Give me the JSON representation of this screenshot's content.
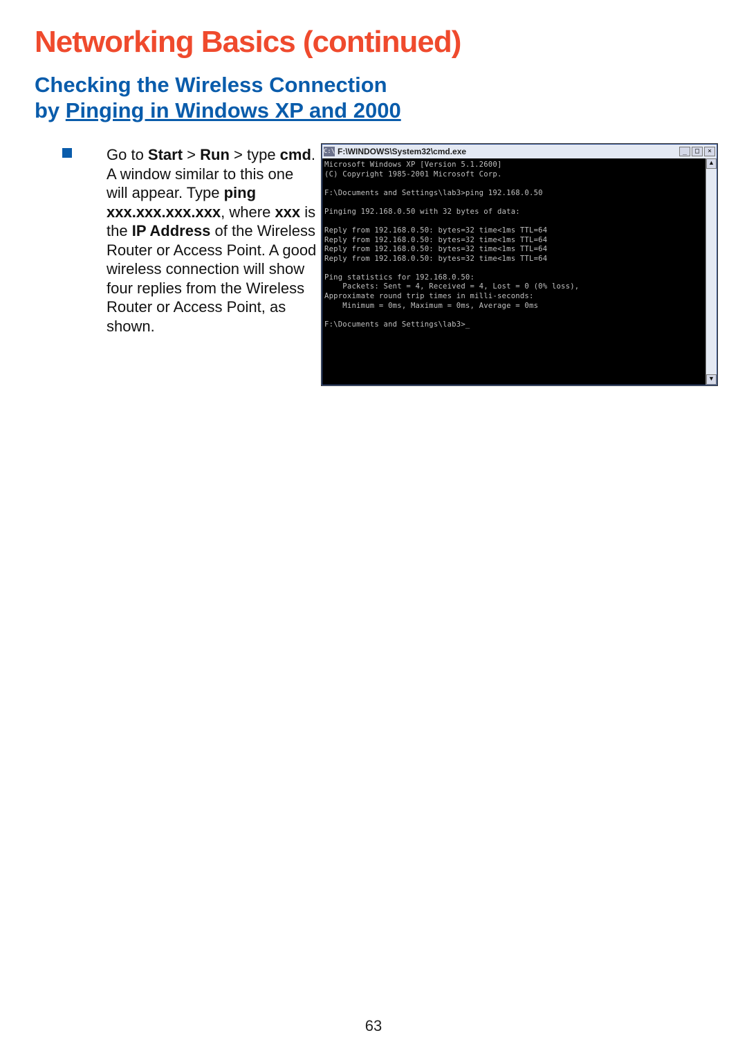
{
  "title": "Networking Basics (continued)",
  "subtitle_line1": "Checking the Wireless Connection",
  "subtitle_line2_prefix": "by ",
  "subtitle_line2_u": "Pinging in Windows XP and 2000",
  "pageNumber": "63",
  "body": {
    "p1": "Go to ",
    "p1b1": "Start",
    "p1gt1": " > ",
    "p1b2": "Run",
    "p1gt2": " > ",
    "p2": "type ",
    "p2b": "cmd",
    "p2rest": ".  A window similar to this one will appear.  Type ",
    "p3b": "ping xxx.xxx.xxx.xxx",
    "p3comma": ", where ",
    "p3b2": "xxx",
    "p3mid": " is the ",
    "p3b3": "IP Address",
    "p3rest": " of the Wireless Router or Access Point.  A good wireless connection will show four replies from the Wireless Router or Access Point, as shown."
  },
  "cmd": {
    "icon_label": "C:\\",
    "title_path": "F:\\WINDOWS\\System32\\cmd.exe",
    "btn_min": "_",
    "btn_max": "□",
    "btn_close": "×",
    "scroll_up": "▲",
    "scroll_down": "▼",
    "lines": [
      "Microsoft Windows XP [Version 5.1.2600]",
      "(C) Copyright 1985-2001 Microsoft Corp.",
      "",
      "F:\\Documents and Settings\\lab3>ping 192.168.0.50",
      "",
      "Pinging 192.168.0.50 with 32 bytes of data:",
      "",
      "Reply from 192.168.0.50: bytes=32 time<1ms TTL=64",
      "Reply from 192.168.0.50: bytes=32 time<1ms TTL=64",
      "Reply from 192.168.0.50: bytes=32 time<1ms TTL=64",
      "Reply from 192.168.0.50: bytes=32 time<1ms TTL=64",
      "",
      "Ping statistics for 192.168.0.50:",
      "    Packets: Sent = 4, Received = 4, Lost = 0 (0% loss),",
      "Approximate round trip times in milli-seconds:",
      "    Minimum = 0ms, Maximum = 0ms, Average = 0ms",
      "",
      "F:\\Documents and Settings\\lab3>_"
    ]
  }
}
